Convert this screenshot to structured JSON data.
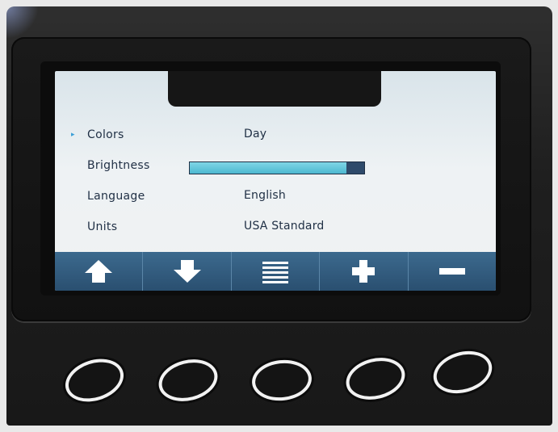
{
  "menu": {
    "items": [
      {
        "label": "Colors",
        "value": "Day",
        "selected": true
      },
      {
        "label": "Brightness",
        "value": null,
        "level": 0.9
      },
      {
        "label": "Language",
        "value": "English"
      },
      {
        "label": "Units",
        "value": "USA Standard"
      }
    ]
  },
  "softkeys": [
    {
      "icon": "arrow-up-icon",
      "action": "up"
    },
    {
      "icon": "arrow-down-icon",
      "action": "down"
    },
    {
      "icon": "menu-lines-icon",
      "action": "menu"
    },
    {
      "icon": "plus-icon",
      "action": "increase"
    },
    {
      "icon": "minus-icon",
      "action": "decrease"
    }
  ],
  "colors": {
    "screen_bg": "#eef2f4",
    "softkey_bar": "#2f5679",
    "accent": "#4db8d0",
    "text": "#1f2f44",
    "cursor": "#3a9fd6"
  },
  "cursor_glyph": "▸"
}
